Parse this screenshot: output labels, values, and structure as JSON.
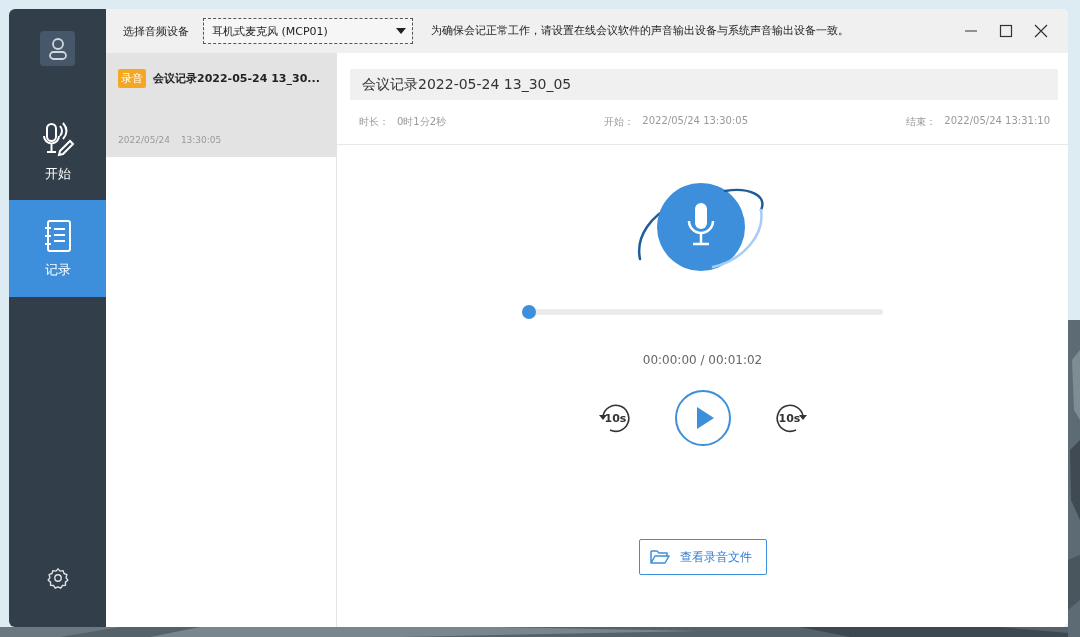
{
  "device_label": "选择音频设备",
  "device_select": {
    "value": "耳机式麦克风 (MCP01)"
  },
  "notice": "为确保会记正常工作，请设置在线会议软件的声音输出设备与系统声音输出设备一致。",
  "nav": [
    {
      "label": "开始",
      "selected": false,
      "kind": "start"
    },
    {
      "label": "记录",
      "selected": true,
      "kind": "records"
    }
  ],
  "records": [
    {
      "tag": "录音",
      "title": "会议记录2022-05-24 13_30...",
      "date": "2022/05/24",
      "time": "13:30:05",
      "selected": true
    }
  ],
  "detail": {
    "title": "会议记录2022-05-24 13_30_05",
    "duration_label": "时长：",
    "duration": "0时1分2秒",
    "start_label": "开始：",
    "start": "2022/05/24 13:30:05",
    "end_label": "结束：",
    "end": "2022/05/24 13:31:10"
  },
  "player": {
    "level": 0,
    "time": "00:00:00 / 00:01:02",
    "back": "10s",
    "forward": "10s"
  },
  "open_button": "查看录音文件"
}
